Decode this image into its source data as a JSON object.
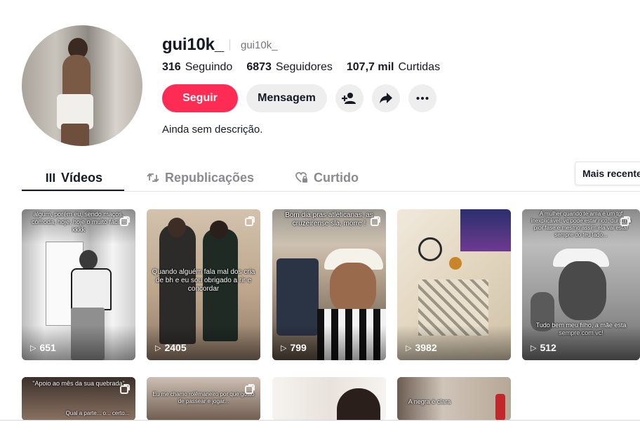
{
  "profile": {
    "username": "gui10k_",
    "handle": "gui10k_",
    "bio": "Ainda sem descrição."
  },
  "stats": {
    "following_count": "316",
    "following_label": "Seguindo",
    "followers_count": "6873",
    "followers_label": "Seguidores",
    "likes_count": "107,7 mil",
    "likes_label": "Curtidas"
  },
  "actions": {
    "follow_label": "Seguir",
    "message_label": "Mensagem",
    "add_friend_icon": "person-plus-icon",
    "share_icon": "share-arrow-icon",
    "more_icon": "ellipsis-icon"
  },
  "tabs": [
    {
      "label": "Vídeos",
      "icon": "grid-bars-icon",
      "active": true
    },
    {
      "label": "Republicações",
      "icon": "repost-icon",
      "active": false
    },
    {
      "label": "Curtido",
      "icon": "heart-lock-icon",
      "active": false
    }
  ],
  "sort": {
    "label": "Mais recente"
  },
  "videos": [
    {
      "views": "651",
      "caption": "algum, porém eu, sendo maços, cômoda, hoje, hoje o muito fácil... kkkk",
      "pinned": true
    },
    {
      "views": "2405",
      "caption": "Quando alguém fala mal dos cria de bh e eu sou obrigado a rir e concordar",
      "pinned": true
    },
    {
      "views": "799",
      "caption": "Bom dia pras atleticanas, as cruzeirense sla, morre !",
      "pinned": true
    },
    {
      "views": "3982",
      "caption": "",
      "pinned": false
    },
    {
      "views": "512",
      "caption": "A mulher quando te ama é um tgf inexplicável, vc pode estar rico, duro, na pior fase e mesmo assim ela vai estar sempre do teu lado...",
      "caption2": "Tudo bem meu filho, a mãe esta sempre com vc!",
      "pinned": true
    },
    {
      "views": "",
      "caption": "\"Apoio ao mês da sua quebrada\"",
      "caption2": "Qual a parte... o... certo...",
      "pinned": false
    },
    {
      "views": "",
      "caption": "Eu me chamo rolêmaneiro por que gosto de passear e jogar...",
      "pinned": false
    },
    {
      "views": "",
      "caption": "",
      "pinned": false
    },
    {
      "views": "",
      "caption": "A negra é clara",
      "pinned": false
    }
  ],
  "colors": {
    "accent": "#fe2c55",
    "text": "#161823",
    "muted": "#8a8b91",
    "button_bg": "#eeeeef"
  }
}
